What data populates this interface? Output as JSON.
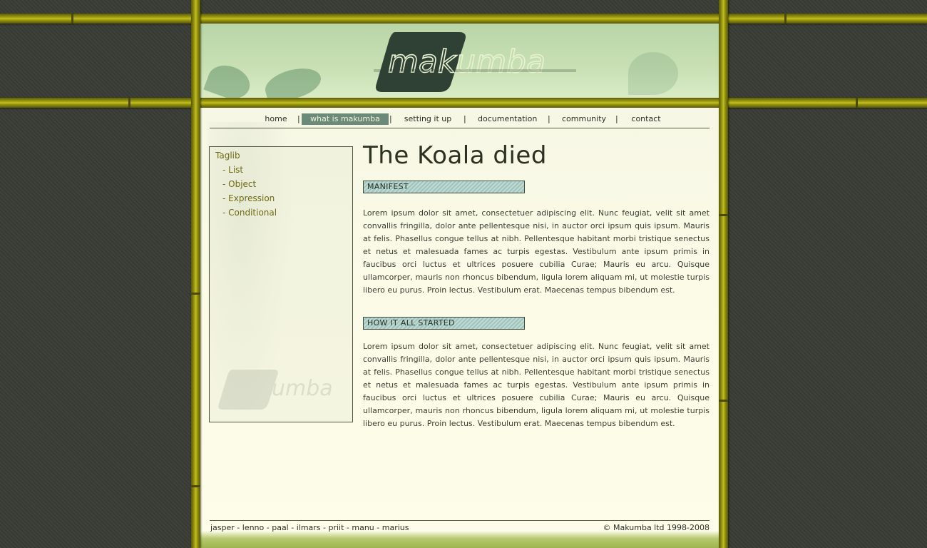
{
  "brand": {
    "logo_text": "makumba"
  },
  "nav": {
    "items": [
      {
        "label": "home"
      },
      {
        "label": "what is makumba"
      },
      {
        "label": "setting it up"
      },
      {
        "label": "documentation"
      },
      {
        "label": "community"
      },
      {
        "label": "contact"
      }
    ],
    "separator": "|"
  },
  "sidebar": {
    "title": "Taglib",
    "items": [
      {
        "label": "- List"
      },
      {
        "label": "- Object"
      },
      {
        "label": "- Expression"
      },
      {
        "label": "- Conditional"
      }
    ]
  },
  "article": {
    "title": "The Koala died",
    "sections": [
      {
        "heading": "MANIFEST",
        "text": "Lorem ipsum dolor sit amet, consectetuer adipiscing elit. Nunc feugiat, velit sit amet convallis fringilla, dolor ante pellentesque nisi, in auctor orci ipsum quis ipsum. Mauris at felis. Phasellus congue tellus at nibh. Pellentesque habitant morbi tristique senectus et netus et malesuada fames ac turpis egestas. Vestibulum ante ipsum primis in faucibus orci luctus et ultrices posuere cubilia Curae; Mauris eu arcu. Quisque ullamcorper, mauris non rhoncus bibendum, ligula lorem aliquam mi, ut molestie turpis libero eu purus. Proin lectus. Vestibulum erat. Maecenas tempus bibendum est."
      },
      {
        "heading": "HOW IT ALL STARTED",
        "text": "Lorem ipsum dolor sit amet, consectetuer adipiscing elit. Nunc feugiat, velit sit amet convallis fringilla, dolor ante pellentesque nisi, in auctor orci ipsum quis ipsum. Mauris at felis. Phasellus congue tellus at nibh. Pellentesque habitant morbi tristique senectus et netus et malesuada fames ac turpis egestas. Vestibulum ante ipsum primis in faucibus orci luctus et ultrices posuere cubilia Curae; Mauris eu arcu. Quisque ullamcorper, mauris non rhoncus bibendum, ligula lorem aliquam mi, ut molestie turpis libero eu purus. Proin lectus. Vestibulum erat. Maecenas tempus bibendum est."
      }
    ]
  },
  "footer": {
    "credits": "jasper - lenno - paal - ilmars - priit - manu - marius",
    "copyright": "© Makumba ltd 1998-2008"
  },
  "colors": {
    "background": "#3a3d36",
    "bamboo": "#9c9a12",
    "page": "#fbfbe8",
    "nav_active": "#6b8a7a",
    "section_head": "#a9cfc6",
    "link": "#6f6a10"
  }
}
